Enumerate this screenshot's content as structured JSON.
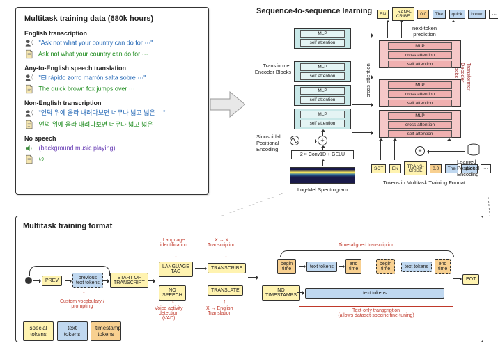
{
  "top_left": {
    "title": "Multitask training data (680k hours)",
    "tasks": [
      {
        "name": "English transcription",
        "audio": "\"Ask not what your country can do for ···\"",
        "text": "Ask not what your country can do for ···"
      },
      {
        "name": "Any-to-English speech translation",
        "audio": "\"El rápido zorro marrón salta sobre ···\"",
        "text": "The quick brown fox jumps over ···"
      },
      {
        "name": "Non-English transcription",
        "audio": "\"언덕 위에 올라 내려다보면 너무나 넓고 넓은 ···\"",
        "text": "언덕 위에 올라 내려다보면 너무나 넓고 넓은 ···"
      },
      {
        "name": "No speech",
        "audio": "(background music playing)",
        "text": "∅"
      }
    ]
  },
  "seq2seq": {
    "title": "Sequence-to-sequence learning",
    "encoder_label": "Transformer\nEncoder Blocks",
    "decoder_label": "Transformer\nDecoder Blocks",
    "cross_attention_label": "cross attention",
    "sin_pos": "Sinusoidal\nPositional\nEncoding",
    "learned_pos": "Learned\nPositional\nEncoding",
    "conv": "2 × Conv1D + GELU",
    "logmel": "Log-Mel Spectrogram",
    "tokens_label": "Tokens in Multitask Training Format",
    "next_token": "next-token\nprediction",
    "enc_sub": [
      "MLP",
      "self attention"
    ],
    "dec_sub": [
      "MLP",
      "cross attention",
      "self attention"
    ],
    "top_tokens": [
      "EN",
      "TRANS-\nCRIBE",
      "0.0",
      "The",
      "quick",
      "brown",
      "···"
    ],
    "bottom_tokens": [
      "SOT",
      "EN",
      "TRANS-\nCRIBE",
      "0.0",
      "The",
      "quick",
      "···"
    ]
  },
  "flow": {
    "title": "Multitask training format",
    "prev": "PREV",
    "prev_tokens": "previous\ntext tokens",
    "sot": "START OF\nTRANSCRIPT",
    "lang": "LANGUAGE\nTAG",
    "nospeech": "NO\nSPEECH",
    "transcribe": "TRANSCRIBE",
    "translate": "TRANSLATE",
    "begin": "begin\ntime",
    "end": "end\ntime",
    "text_tokens": "text tokens",
    "nots": "NO\nTIMESTAMPS",
    "eot": "EOT",
    "annotations": {
      "custom": "Custom vocabulary /\nprompting",
      "langid": "Language\nidentification",
      "xtx": "X → X\nTranscription",
      "vad": "Voice activity\ndetection\n(VAD)",
      "xeng": "X → English\nTranslation",
      "time_aligned": "Time-aligned transcription",
      "text_only": "Text-only transcription\n(allows dataset-specific fine-tuning)"
    },
    "legend": {
      "special": "special\ntokens",
      "text": "text\ntokens",
      "ts": "timestamp\ntokens"
    }
  }
}
